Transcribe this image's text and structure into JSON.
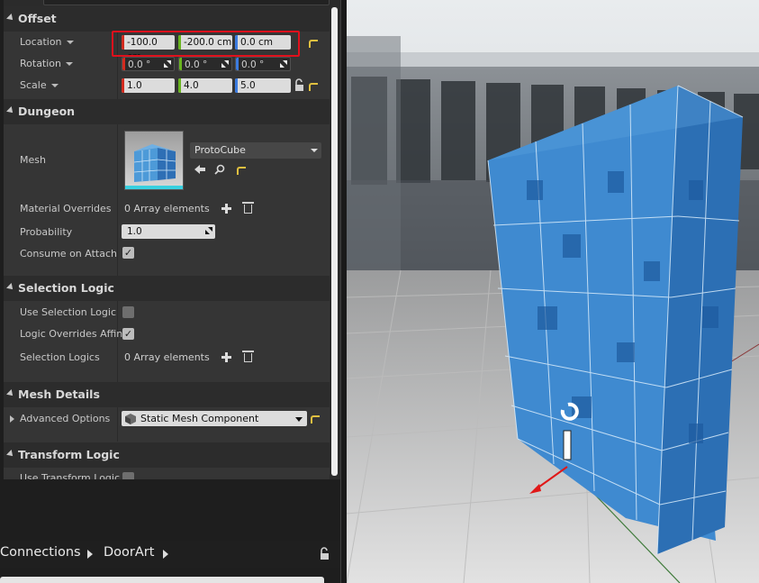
{
  "details": {
    "categories": {
      "offset": "Offset",
      "dungeon": "Dungeon",
      "selection_logic": "Selection Logic",
      "mesh_details": "Mesh Details",
      "transform_logic": "Transform Logic"
    },
    "offset": {
      "location": {
        "label": "Location",
        "x": "-100.0 cm",
        "y": "-200.0 cm",
        "z": "0.0 cm"
      },
      "rotation": {
        "label": "Rotation",
        "x": "0.0 °",
        "y": "0.0 °",
        "z": "0.0 °"
      },
      "scale": {
        "label": "Scale",
        "x": "1.0",
        "y": "4.0",
        "z": "5.0"
      }
    },
    "dungeon": {
      "mesh_label": "Mesh",
      "mesh_value": "ProtoCube",
      "material_overrides_label": "Material Overrides",
      "material_overrides_value": "0 Array elements",
      "probability_label": "Probability",
      "probability_value": "1.0",
      "consume_label": "Consume on Attach",
      "consume_checked": true
    },
    "selection_logic": {
      "use_label": "Use Selection Logic",
      "use_checked": false,
      "overrides_label": "Logic Overrides Affin",
      "overrides_checked": true,
      "logics_label": "Selection Logics",
      "logics_value": "0 Array elements"
    },
    "mesh_details": {
      "advanced_label": "Advanced Options",
      "component_value": "Static Mesh Component"
    },
    "transform_logic": {
      "use_label": "Use Transform Logic"
    }
  },
  "breadcrumbs": {
    "items": [
      "Connections",
      "DoorArt"
    ]
  },
  "colors": {
    "axis_x": "#d32b1f",
    "axis_y": "#69b41f",
    "axis_z": "#3b7be0",
    "highlight": "#e0101c",
    "panel": "#353535",
    "cube_blue": "#3f8ad0"
  },
  "icons": {
    "lock": "lock-icon",
    "reset": "reset-arrow-icon",
    "browse": "browse-arrow-icon",
    "search": "search-icon",
    "add": "plus-icon",
    "delete": "trash-icon"
  }
}
